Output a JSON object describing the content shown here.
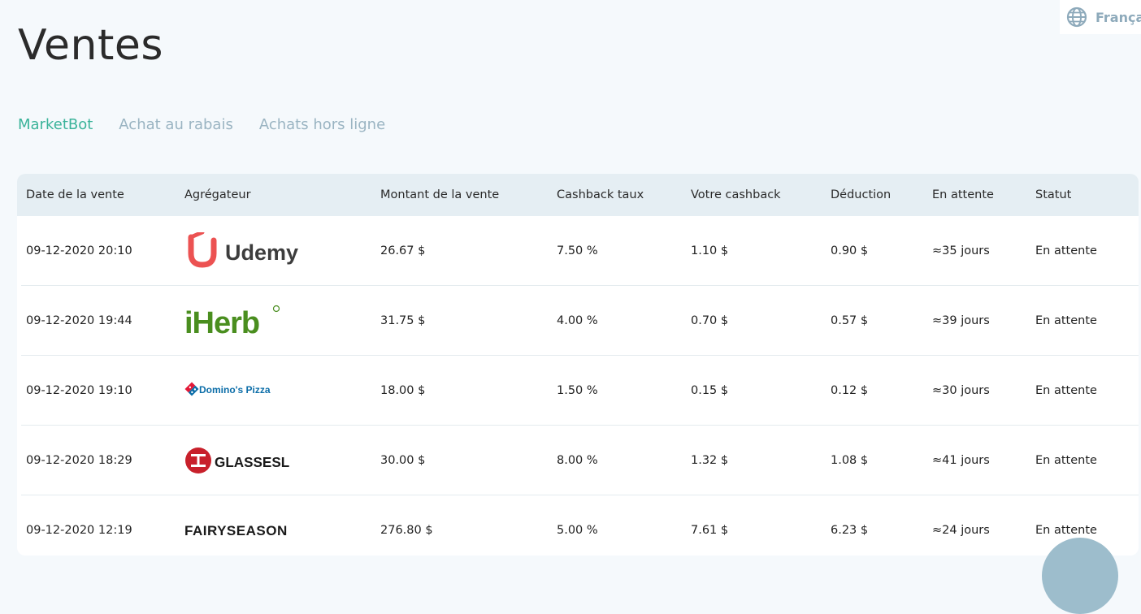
{
  "language": {
    "label": "Françai"
  },
  "page": {
    "title": "Ventes"
  },
  "tabs": [
    {
      "label": "MarketBot",
      "active": true
    },
    {
      "label": "Achat au rabais",
      "active": false
    },
    {
      "label": "Achats hors ligne",
      "active": false
    }
  ],
  "table": {
    "headers": [
      "Date de la vente",
      "Agrégateur",
      "Montant de la vente",
      "Cashback taux",
      "Votre cashback",
      "Déduction",
      "En attente",
      "Statut"
    ],
    "rows": [
      {
        "date": "09-12-2020 20:10",
        "aggregator": "Udemy",
        "amount": "26.67 $",
        "rate": "7.50 %",
        "cashback": "1.10 $",
        "deduction": "0.90 $",
        "pending": "≈35 jours",
        "status": "En attente"
      },
      {
        "date": "09-12-2020 19:44",
        "aggregator": "iHerb",
        "amount": "31.75 $",
        "rate": "4.00 %",
        "cashback": "0.70 $",
        "deduction": "0.57 $",
        "pending": "≈39 jours",
        "status": "En attente"
      },
      {
        "date": "09-12-2020 19:10",
        "aggregator": "Domino's Pizza",
        "amount": "18.00 $",
        "rate": "1.50 %",
        "cashback": "0.15 $",
        "deduction": "0.12 $",
        "pending": "≈30 jours",
        "status": "En attente"
      },
      {
        "date": "09-12-2020 18:29",
        "aggregator": "GLASSESLIT",
        "amount": "30.00 $",
        "rate": "8.00 %",
        "cashback": "1.32 $",
        "deduction": "1.08 $",
        "pending": "≈41 jours",
        "status": "En attente"
      },
      {
        "date": "09-12-2020 12:19",
        "aggregator": "FAIRYSEASON",
        "amount": "276.80 $",
        "rate": "5.00 %",
        "cashback": "7.61 $",
        "deduction": "6.23 $",
        "pending": "≈24 jours",
        "status": "En attente"
      }
    ]
  },
  "colors": {
    "accent": "#3bb39a",
    "tab_inactive": "#9ab4c2",
    "header_bg": "#e5eef3",
    "page_bg": "#f5f9fc"
  }
}
